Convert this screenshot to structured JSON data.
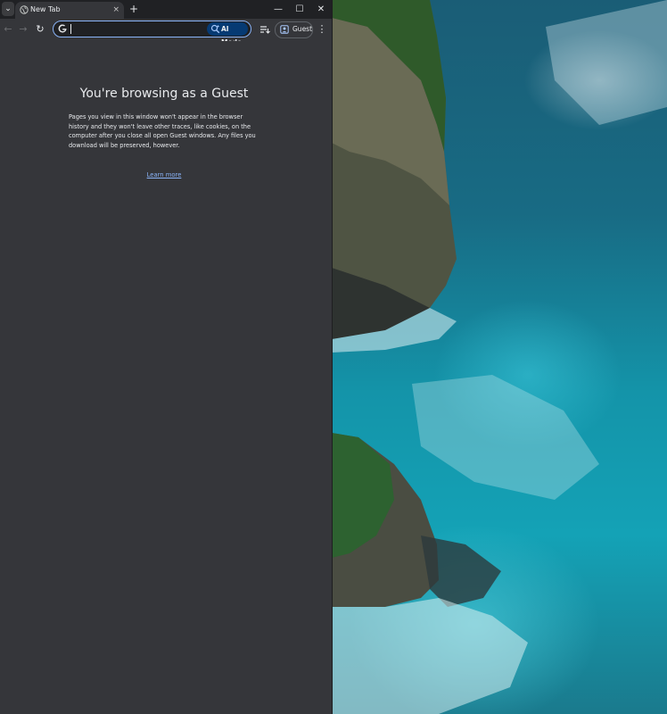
{
  "window": {
    "tab_title": "New Tab",
    "tab_close_glyph": "×",
    "new_tab_glyph": "+",
    "controls": {
      "minimize": "—",
      "maximize": "☐",
      "close": "✕"
    }
  },
  "toolbar": {
    "back_glyph": "←",
    "forward_glyph": "→",
    "reload_glyph": "↻",
    "omnibox_value": "",
    "omnibox_placeholder": "",
    "ai_mode_label": "AI Mode",
    "profile_label": "Guest",
    "menu_glyph": "⋮"
  },
  "page": {
    "title": "You're browsing as a Guest",
    "description": "Pages you view in this window won't appear in the browser history and they won't leave other traces, like cookies, on the computer after you close all open Guest windows. Any files you download will be preserved, however.",
    "learn_more": "Learn more"
  },
  "colors": {
    "frame": "#202124",
    "page_background": "#35363a",
    "omnibox_focus": "#8ab4f8",
    "link": "#8ab4f8",
    "ai_mode_bg": "#063a73"
  },
  "icons": {
    "tab_search": "chevron-down-icon",
    "tab_favicon": "globe-icon",
    "omnibox_logo": "google-g-icon",
    "ai_mode": "ai-search-icon",
    "reading_list": "reading-list-icon",
    "profile": "guest-profile-icon"
  }
}
